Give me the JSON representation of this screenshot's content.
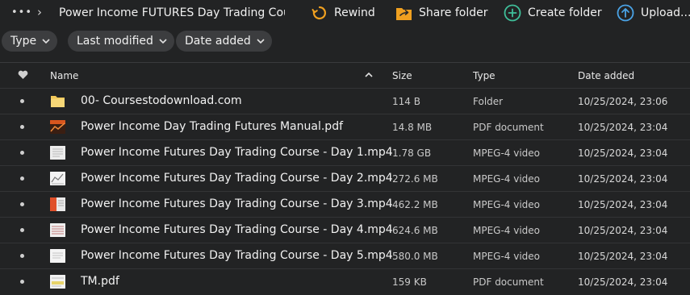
{
  "breadcrumb": {
    "more_label": "•••",
    "separator": "›",
    "title": "Power Income FUTURES Day Trading Cou..."
  },
  "toolbar": {
    "rewind": "Rewind",
    "share_folder": "Share folder",
    "create_folder": "Create folder",
    "upload": "Upload..."
  },
  "filters": [
    "Type",
    "Last modified",
    "Date added"
  ],
  "columns": {
    "name": "Name",
    "size": "Size",
    "type": "Type",
    "date_added": "Date added"
  },
  "files": [
    {
      "name": "00- Coursestodownload.com",
      "size": "114 B",
      "type": "Folder",
      "date": "10/25/2024, 23:06",
      "icon": "folder-icon"
    },
    {
      "name": "Power Income Day Trading Futures Manual.pdf",
      "size": "14.8 MB",
      "type": "PDF document",
      "date": "10/25/2024, 23:04",
      "icon": "pdf-thumbnail-icon"
    },
    {
      "name": "Power Income Futures Day Trading Course - Day 1.mp4",
      "size": "1.78 GB",
      "type": "MPEG-4 video",
      "date": "10/25/2024, 23:04",
      "icon": "video-thumbnail-icon"
    },
    {
      "name": "Power Income Futures Day Trading Course - Day 2.mp4",
      "size": "272.6 MB",
      "type": "MPEG-4 video",
      "date": "10/25/2024, 23:04",
      "icon": "video-thumbnail-icon"
    },
    {
      "name": "Power Income Futures Day Trading Course - Day 3.mp4",
      "size": "462.2 MB",
      "type": "MPEG-4 video",
      "date": "10/25/2024, 23:04",
      "icon": "video-thumbnail-icon"
    },
    {
      "name": "Power Income Futures Day Trading Course - Day 4.mp4",
      "size": "624.6 MB",
      "type": "MPEG-4 video",
      "date": "10/25/2024, 23:04",
      "icon": "video-thumbnail-icon"
    },
    {
      "name": "Power Income Futures Day Trading Course - Day 5.mp4",
      "size": "580.0 MB",
      "type": "MPEG-4 video",
      "date": "10/25/2024, 23:04",
      "icon": "video-thumbnail-icon"
    },
    {
      "name": "TM.pdf",
      "size": "159 KB",
      "type": "PDF document",
      "date": "10/25/2024, 23:04",
      "icon": "pdf-thumbnail-icon"
    }
  ],
  "colors": {
    "accent_orange": "#f0a020",
    "accent_green": "#3fbf9a",
    "accent_blue": "#4aa3e6",
    "background": "#222324"
  }
}
